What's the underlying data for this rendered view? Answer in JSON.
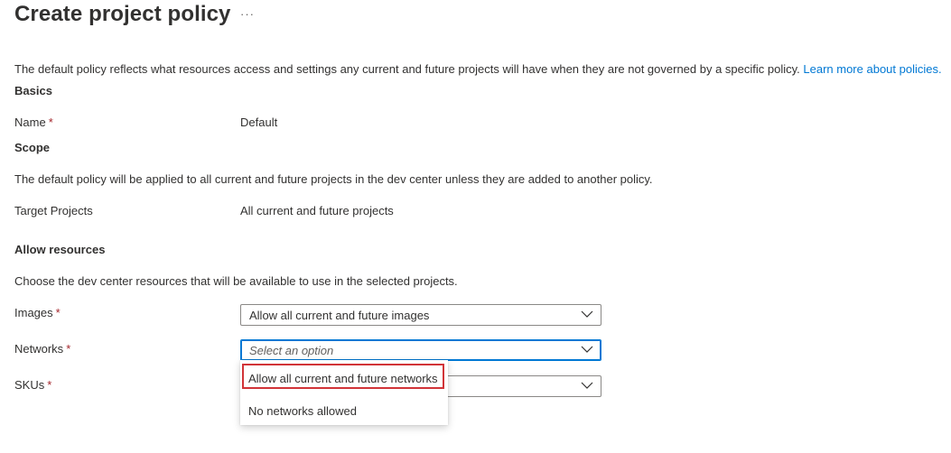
{
  "header": {
    "title": "Create project policy",
    "more_label": "···"
  },
  "intro": {
    "text": "The default policy reflects what resources access and settings any current and future projects will have when they are not governed by a specific policy. ",
    "link": "Learn more about policies."
  },
  "basics": {
    "heading": "Basics",
    "name_label": "Name",
    "required_mark": "*",
    "name_value": "Default"
  },
  "scope": {
    "heading": "Scope",
    "description": "The default policy will be applied to all current and future projects in the dev center unless they are added to another policy.",
    "target_label": "Target Projects",
    "target_value": "All current and future projects"
  },
  "allow": {
    "heading": "Allow resources",
    "description": "Choose the dev center resources that will be available to use in the selected projects.",
    "images_label": "Images",
    "images_value": "Allow all current and future images",
    "networks_label": "Networks",
    "networks_placeholder": "Select an option",
    "skus_label": "SKUs",
    "skus_value": ""
  },
  "networks_menu": {
    "options": [
      {
        "label": "Allow all current and future networks"
      },
      {
        "label": "No networks allowed"
      }
    ]
  },
  "colors": {
    "accent": "#0078d4",
    "required": "#a4262c",
    "highlight_box": "#d13438"
  },
  "icons": {
    "dropdown": "chevron-down-icon"
  }
}
